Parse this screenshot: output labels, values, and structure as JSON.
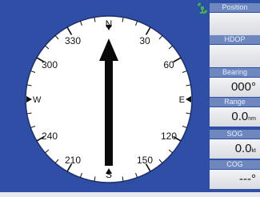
{
  "compass": {
    "labels": {
      "n": "N",
      "s": "S",
      "e": "E",
      "w": "W",
      "d30": "30",
      "d60": "60",
      "d120": "120",
      "d150": "150",
      "d210": "210",
      "d240": "240",
      "d300": "300",
      "d330": "330"
    },
    "heading_deg": 0
  },
  "status": {
    "gps_icon": "satellite-icon",
    "gps_color": "#3fb24a"
  },
  "panel": {
    "position": {
      "label": "Position",
      "value": ""
    },
    "hdop": {
      "label": "HDOP",
      "value": ""
    },
    "bearing": {
      "label": "Bearing",
      "value": "000°"
    },
    "range": {
      "label": "Range",
      "value": "0.0",
      "unit": "nm"
    },
    "sog": {
      "label": "SOG",
      "value": "0.0",
      "unit": "kt"
    },
    "cog": {
      "label": "COG",
      "value": "---°"
    }
  },
  "colors": {
    "background": "#2f4fa6",
    "label_bar": "#6e88bf",
    "dial": "#ffffff"
  }
}
